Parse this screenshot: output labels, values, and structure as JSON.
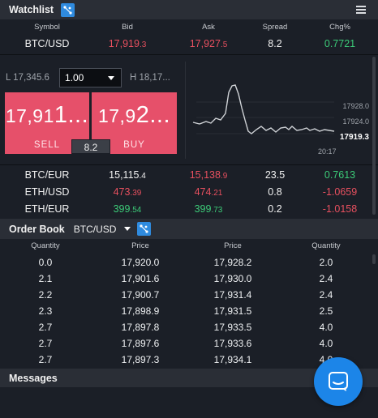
{
  "watchlist": {
    "title": "Watchlist",
    "columns": {
      "symbol": "Symbol",
      "bid": "Bid",
      "ask": "Ask",
      "spread": "Spread",
      "chg": "Chg%"
    },
    "top_row": {
      "symbol": "BTC/USD",
      "bid_a": "17,919",
      "bid_b": ".3",
      "ask_a": "17,927",
      "ask_b": ".5",
      "spread": "8.2",
      "chg": "0.7721"
    },
    "rows": [
      {
        "symbol": "BTC/EUR",
        "bid_a": "15,115",
        "bid_b": ".4",
        "ask_a": "15,138",
        "ask_b": ".9",
        "spread": "23.5",
        "chg": "0.7613"
      },
      {
        "symbol": "ETH/USD",
        "bid_a": "473",
        "bid_b": ".39",
        "ask_a": "474",
        "ask_b": ".21",
        "spread": "0.8",
        "chg": "-1.0659"
      },
      {
        "symbol": "ETH/EUR",
        "bid_a": "399",
        "bid_b": ".54",
        "ask_a": "399",
        "ask_b": ".73",
        "spread": "0.2",
        "chg": "-1.0158"
      }
    ]
  },
  "trade": {
    "low": "L 17,345.6",
    "quantity": "1.00",
    "high": "H 18,17...",
    "sell": {
      "price_a": "17,91",
      "price_b": "1...",
      "label": "SELL"
    },
    "buy": {
      "price_a": "17,9",
      "price_b": "2...",
      "label": "BUY"
    },
    "spread": "8.2",
    "chart": {
      "y_labels": [
        "17928.0",
        "17924.0"
      ],
      "current": "17919.3",
      "time_label": "20:17"
    }
  },
  "order_book": {
    "title": "Order Book",
    "symbol": "BTC/USD",
    "columns": [
      "Quantity",
      "Price",
      "Price",
      "Quantity"
    ],
    "rows": [
      [
        "0.0",
        "17,920.0",
        "17,928.2",
        "2.0"
      ],
      [
        "2.1",
        "17,901.6",
        "17,930.0",
        "2.4"
      ],
      [
        "2.2",
        "17,900.7",
        "17,931.4",
        "2.4"
      ],
      [
        "2.3",
        "17,898.9",
        "17,931.5",
        "2.5"
      ],
      [
        "2.7",
        "17,897.8",
        "17,933.5",
        "4.0"
      ],
      [
        "2.7",
        "17,897.6",
        "17,933.6",
        "4.0"
      ],
      [
        "2.7",
        "17,897.3",
        "17,934.1",
        "4.0"
      ]
    ]
  },
  "messages": {
    "title": "Messages"
  },
  "icons": {
    "link": "link-chain-icon",
    "menu": "hamburger-menu-icon",
    "chat": "chat-bubble-icon"
  },
  "colors": {
    "accent": "#2f8bdf",
    "sell_buy": "#e6506a",
    "up": "#3ccb78",
    "down": "#e8505f"
  }
}
